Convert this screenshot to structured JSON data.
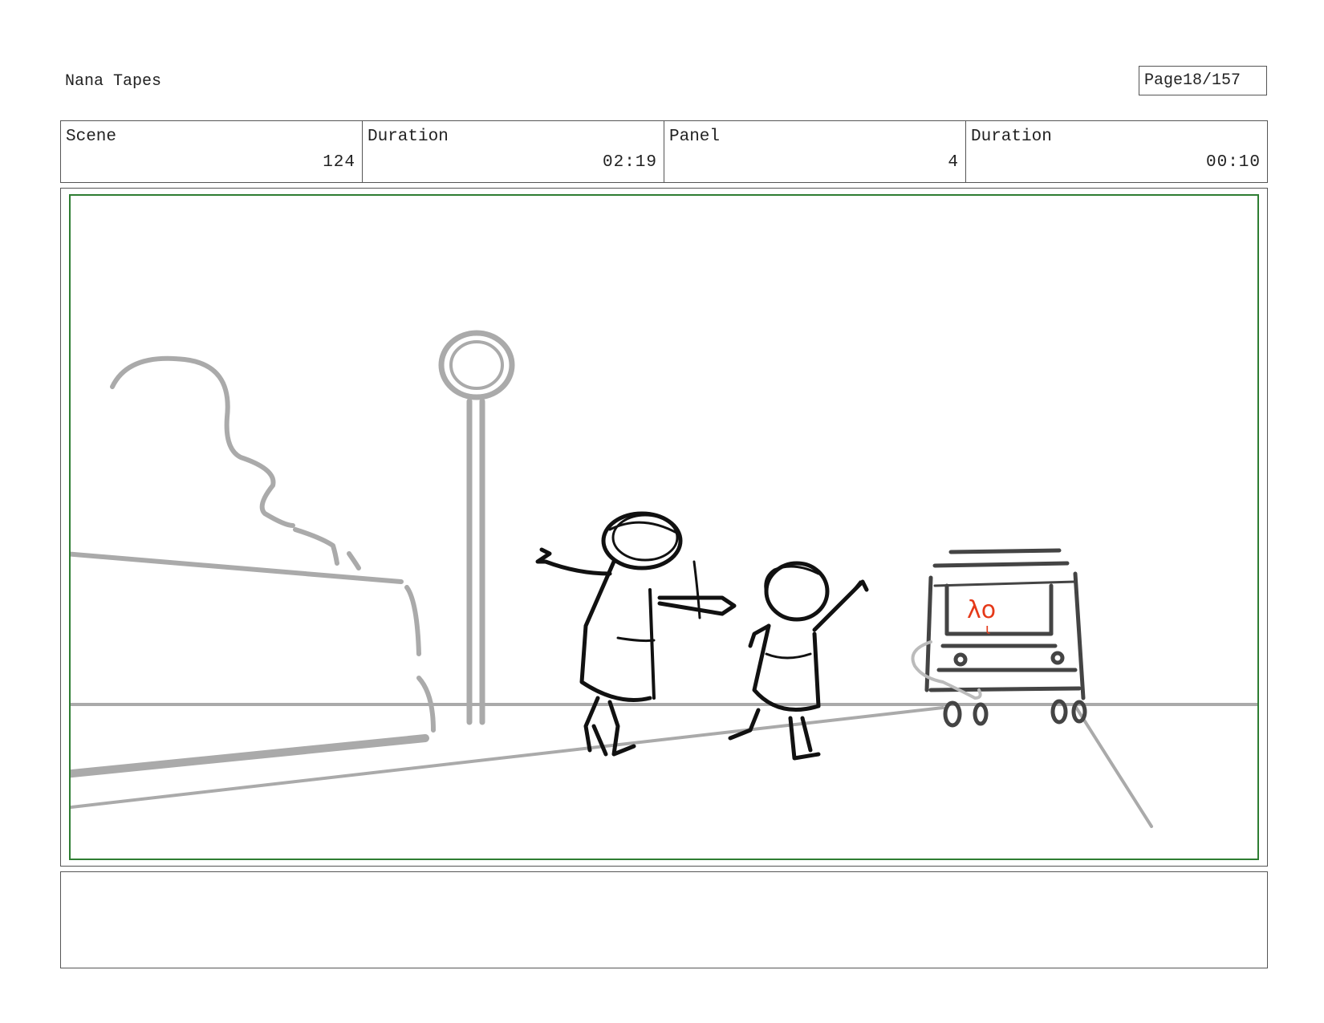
{
  "header": {
    "project_title": "Nana Tapes",
    "page_label": "Page",
    "page_value": "18/157"
  },
  "info": {
    "scene_label": "Scene",
    "scene_value": "124",
    "scene_duration_label": "Duration",
    "scene_duration_value": "02:19",
    "panel_label": "Panel",
    "panel_value": "4",
    "panel_duration_label": "Duration",
    "panel_duration_value": "00:10"
  },
  "frame": {
    "border_color": "#2e7d32",
    "sketch_ink": "#111111",
    "background_ink": "#aaaaaa",
    "accent_ink": "#e53919",
    "bus_marking_text": "λo‌"
  },
  "notes": {
    "text": ""
  }
}
